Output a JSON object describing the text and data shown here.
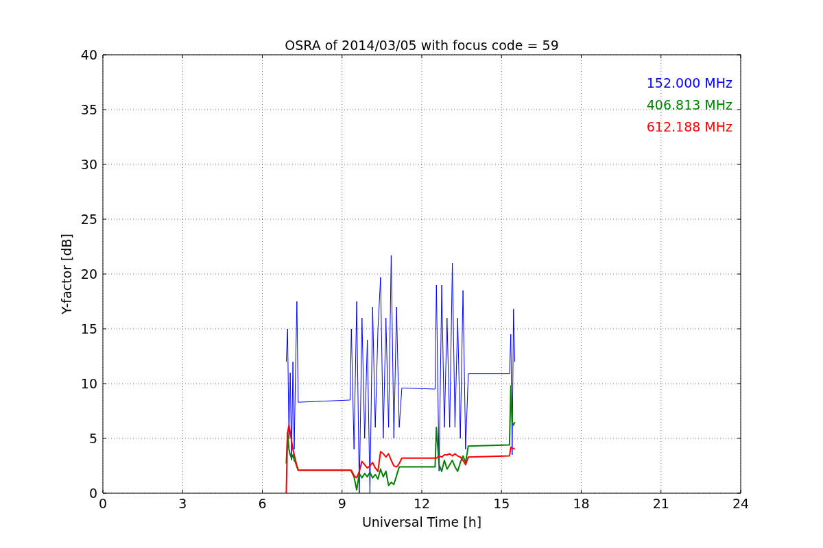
{
  "chart_data": {
    "type": "line",
    "grid": true,
    "title": "OSRA of 2014/03/05 with focus code = 59",
    "xlabel": "Universal Time [h]",
    "ylabel": "Y-factor [dB]",
    "xlim": [
      0,
      24
    ],
    "ylim": [
      0,
      40
    ],
    "xticks": [
      0,
      3,
      6,
      9,
      12,
      15,
      18,
      21,
      24
    ],
    "yticks": [
      0,
      5,
      10,
      15,
      20,
      25,
      30,
      35,
      40
    ],
    "x": [
      6.9,
      6.95,
      7.0,
      7.05,
      7.1,
      7.15,
      7.2,
      7.25,
      7.3,
      7.35,
      9.3,
      9.35,
      9.45,
      9.55,
      9.65,
      9.75,
      9.85,
      9.95,
      10.05,
      10.15,
      10.25,
      10.35,
      10.45,
      10.55,
      10.65,
      10.75,
      10.85,
      10.95,
      11.05,
      11.15,
      11.25,
      12.5,
      12.55,
      12.65,
      12.75,
      12.85,
      12.95,
      13.05,
      13.15,
      13.25,
      13.35,
      13.45,
      13.55,
      13.65,
      13.75,
      15.3,
      15.35,
      15.4,
      15.45,
      15.5
    ],
    "series": [
      {
        "name": "152.000 MHz",
        "color": "#0000ff",
        "values": [
          12,
          15,
          5,
          11,
          3,
          12,
          4,
          11,
          17.5,
          8.3,
          8.5,
          15,
          4,
          17.5,
          0,
          16,
          5,
          14,
          0,
          17,
          6,
          15,
          19.7,
          5,
          16,
          6,
          21.7,
          5,
          17,
          6,
          9.6,
          9.5,
          19,
          2,
          19,
          6,
          16,
          6,
          21,
          6,
          16,
          5,
          18.5,
          4,
          10.9,
          10.9,
          14.5,
          3.5,
          16.8,
          12
        ]
      },
      {
        "name": "406.813 MHz",
        "color": "#008000",
        "values": [
          2.7,
          5.5,
          4,
          3.5,
          3.2,
          3.5,
          3,
          2.8,
          2.4,
          2.1,
          2.1,
          2.0,
          1.5,
          0.3,
          1.8,
          1.4,
          1.8,
          1.5,
          1.9,
          1.4,
          1.7,
          1.3,
          2.2,
          1.5,
          2.0,
          0.7,
          1.0,
          0.8,
          1.6,
          2.4,
          2.4,
          2.4,
          6,
          2.6,
          2.0,
          3.0,
          2.2,
          2.6,
          3.0,
          2.4,
          2.0,
          2.8,
          3.4,
          2.8,
          4.3,
          4.4,
          9.8,
          6.5,
          6.2,
          6.5
        ]
      },
      {
        "name": "612.188 MHz",
        "color": "#ff0000",
        "values": [
          0,
          5.5,
          6.2,
          5.5,
          4.8,
          4.0,
          3.5,
          3.0,
          2.5,
          2.1,
          2.1,
          2.1,
          1.6,
          1.4,
          2.0,
          2.9,
          2.6,
          2.3,
          2.5,
          2.8,
          2.3,
          2.0,
          3.8,
          3.6,
          3.3,
          3.6,
          3.0,
          2.5,
          2.4,
          2.7,
          3.2,
          3.2,
          3.2,
          3.4,
          3.3,
          3.5,
          3.5,
          3.6,
          3.4,
          3.6,
          3.4,
          3.3,
          3.0,
          2.6,
          3.3,
          3.4,
          4.2,
          4.1,
          4.1,
          4.0
        ]
      }
    ]
  }
}
